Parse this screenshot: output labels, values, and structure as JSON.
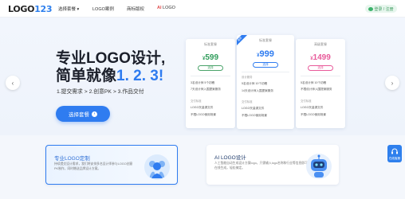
{
  "header": {
    "logo_text": "LOGO",
    "logo_num": "123",
    "nav": [
      {
        "label": "选择套餐 ▾"
      },
      {
        "label": "LOGO案例"
      },
      {
        "label": "商标版权"
      },
      {
        "label_ai": "AI",
        "label_rest": " LOGO"
      }
    ],
    "login_label": "登录 / 注册"
  },
  "hero": {
    "title_line1": "专业LOGO设计,",
    "title_line2_prefix": "简单就像",
    "title_line2_highlight": "1. 2. 3!",
    "steps": "1.提交需求 > 2.创意PK > 3.作品交付",
    "cta_label": "选择套餐",
    "prev_icon": "‹",
    "next_icon": "›"
  },
  "pricing": [
    {
      "title": "标准套餐",
      "price": "599",
      "currency": "¥",
      "button": "选择",
      "price_color": "#2f9c5a",
      "lines_a": [
        "3名设计师 5个初稿",
        "7天设计师入围提案服务"
      ],
      "section_b": "交付标准",
      "lines_b": [
        "LOGO矢量源文件",
        "不限LOGO使用场景"
      ]
    },
    {
      "title": "标准套餐",
      "price": "999",
      "currency": "¥",
      "button": "选择",
      "price_color": "#2f7cf0",
      "ribbon": "推荐",
      "section_a": "设计服务",
      "lines_a": [
        "5名设计师 10个初稿",
        "14天设计师入围提案服务"
      ],
      "section_b": "交付标准",
      "lines_b": [
        "LOGO矢量源文件",
        "不限LOGO使用场景"
      ]
    },
    {
      "title": "高级套餐",
      "price": "1499",
      "currency": "¥",
      "button": "选择",
      "price_color": "#e85a9a",
      "lines_a": [
        "5名设计师 10个初稿",
        "不限设计师入围提案服务"
      ],
      "section_b": "交付标准",
      "lines_b": [
        "LOGO矢量源文件",
        "不限LOGO使用场景"
      ]
    }
  ],
  "features": [
    {
      "title": "专业LOGO定制",
      "desc": "持续提交设计需求，我们将安排多名设计师参与LOGO创意PK制作，同时赠送品牌设计方案。"
    },
    {
      "title": "AI LOGO设计",
      "desc": "人工智能自动生成设计方案logo，只需输入logo名称和行业等信息即可在线生成，轻松搞定。"
    }
  ],
  "service": {
    "label": "在线客服"
  },
  "colors": {
    "accent": "#2f7cf0",
    "background": "#f4f7fc"
  }
}
